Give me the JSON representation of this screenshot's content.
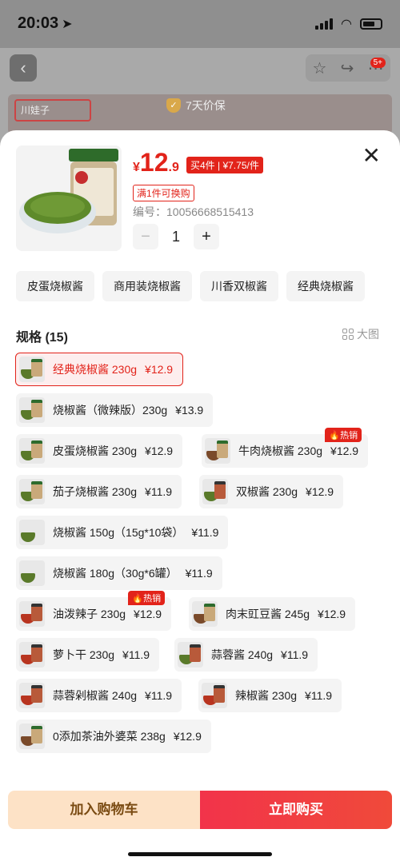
{
  "status_bar": {
    "time": "20:03"
  },
  "nav": {
    "cart_badge": "5+"
  },
  "banner": {
    "brand": "川娃子",
    "guarantee": "7天价保"
  },
  "product": {
    "price_yen": "¥",
    "price_int": "12",
    "price_dec": ".9",
    "promo": "买4件 | ¥7.75/件",
    "swap": "满1件可换购",
    "sku_no": "编号：10056668515413",
    "quantity": "1",
    "minus": "−",
    "plus": "+"
  },
  "quick_chips": [
    "皮蛋烧椒酱",
    "商用装烧椒酱",
    "川香双椒酱",
    "经典烧椒酱"
  ],
  "spec_section": {
    "title": "规格 (15)",
    "big_view": "大图"
  },
  "specs": [
    {
      "name": "经典烧椒酱 230g",
      "price": "¥12.9",
      "selected": true
    },
    {
      "name": "烧椒酱（微辣版）230g",
      "price": "¥13.9"
    },
    {
      "name": "皮蛋烧椒酱 230g",
      "price": "¥12.9"
    },
    {
      "name": "牛肉烧椒酱 230g",
      "price": "¥12.9",
      "tag": "热销"
    },
    {
      "name": "茄子烧椒酱 230g",
      "price": "¥11.9"
    },
    {
      "name": "双椒酱 230g",
      "price": "¥12.9"
    },
    {
      "name": "烧椒酱 150g（15g*10袋）",
      "price": "¥11.9"
    },
    {
      "name": "烧椒酱 180g（30g*6罐）",
      "price": "¥11.9"
    },
    {
      "name": "油泼辣子 230g",
      "price": "¥12.9",
      "tag": "热销"
    },
    {
      "name": "肉末豇豆酱 245g",
      "price": "¥12.9"
    },
    {
      "name": "萝卜干 230g",
      "price": "¥11.9"
    },
    {
      "name": "蒜蓉酱 240g",
      "price": "¥11.9"
    },
    {
      "name": "蒜蓉剁椒酱 240g",
      "price": "¥11.9"
    },
    {
      "name": "辣椒酱 230g",
      "price": "¥11.9"
    },
    {
      "name": "0添加茶油外婆菜 238g",
      "price": "¥12.9"
    }
  ],
  "actions": {
    "add_to_cart": "加入购物车",
    "buy_now": "立即购买"
  },
  "colors": {
    "accent": "#e2231a",
    "cart_bg": "#fde2c6",
    "buy_bg": "#f2334a"
  }
}
